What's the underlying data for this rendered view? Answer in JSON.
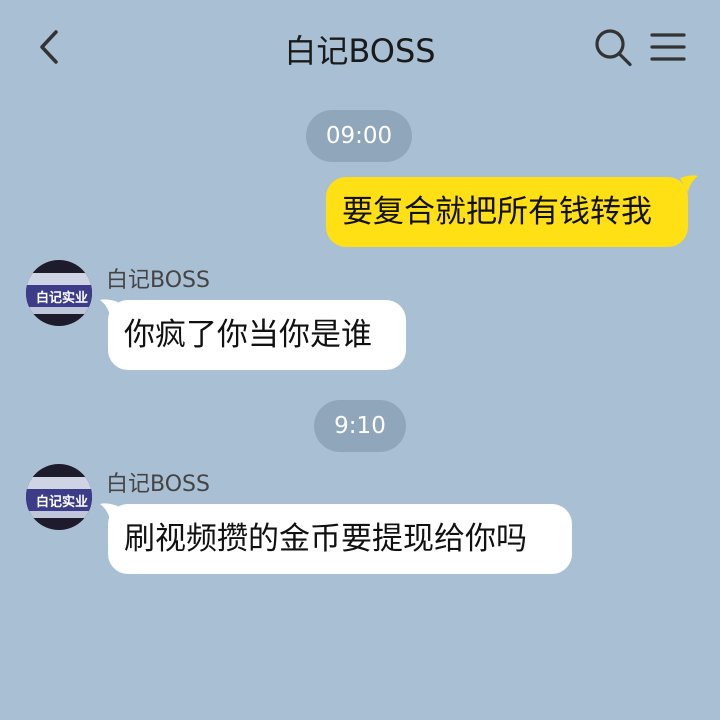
{
  "header": {
    "title": "白记BOSS",
    "icons": {
      "back": "back-arrow-icon",
      "search": "search-icon",
      "menu": "menu-icon"
    }
  },
  "messages": [
    {
      "type": "time",
      "text": "09:00"
    },
    {
      "type": "outgoing",
      "text": "要复合就把所有钱转我"
    },
    {
      "type": "incoming",
      "sender": "白记BOSS",
      "text": "你疯了你当你是谁",
      "avatar_text": "白记实业"
    },
    {
      "type": "time",
      "text": "9:10"
    },
    {
      "type": "incoming",
      "sender": "白记BOSS",
      "text": "刷视频攒的金币要提现给你吗",
      "avatar_text": "白记实业"
    }
  ],
  "colors": {
    "background": "#a9bfd3",
    "outgoing_bubble": "#ffe014",
    "incoming_bubble": "#ffffff",
    "time_pill": "#8fa6bb"
  }
}
